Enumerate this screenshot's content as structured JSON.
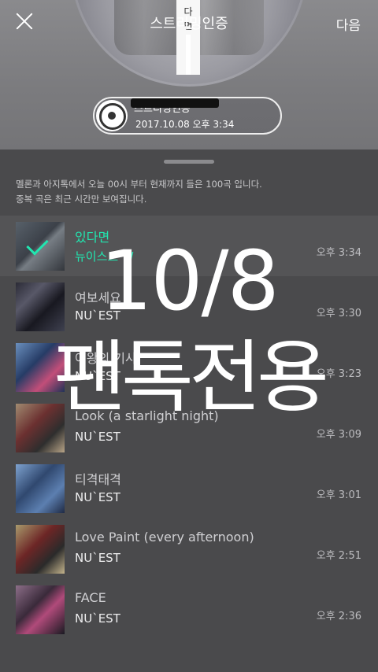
{
  "header": {
    "title": "스트리밍인증",
    "next_label": "다음",
    "badge_chars": [
      "다",
      "면"
    ]
  },
  "certificate": {
    "label": "스트리밍인증",
    "datetime": "2017.10.08 오후 3:34"
  },
  "notice": {
    "line1": "멜론과 아지톡에서 오늘 00시 부터 현재까지 들은 100곡 입니다.",
    "line2": "중복 곡은 최근 시간만 보여집니다."
  },
  "songs": [
    {
      "title": "있다면",
      "artist": "뉴이스트 W",
      "time": "오후 3:34",
      "selected": true
    },
    {
      "title": "여보세요",
      "artist": "NU`EST",
      "time": "오후 3:30",
      "selected": false
    },
    {
      "title": "여왕의 기사",
      "artist": "NU`EST",
      "time": "오후 3:23",
      "selected": false
    },
    {
      "title": "Look (a starlight night)",
      "artist": "NU`EST",
      "time": "오후 3:09",
      "selected": false
    },
    {
      "title": "티격태격",
      "artist": "NU`EST",
      "time": "오후 3:01",
      "selected": false
    },
    {
      "title": "Love Paint (every afternoon)",
      "artist": "NU`EST",
      "time": "오후 2:51",
      "selected": false
    },
    {
      "title": "FACE",
      "artist": "NU`EST",
      "time": "오후 2:36",
      "selected": false
    }
  ],
  "watermark": {
    "date": "10/8",
    "text": "팬톡전용"
  },
  "colors": {
    "accent": "#21e6b0",
    "sheet": "#4a4a4c"
  }
}
